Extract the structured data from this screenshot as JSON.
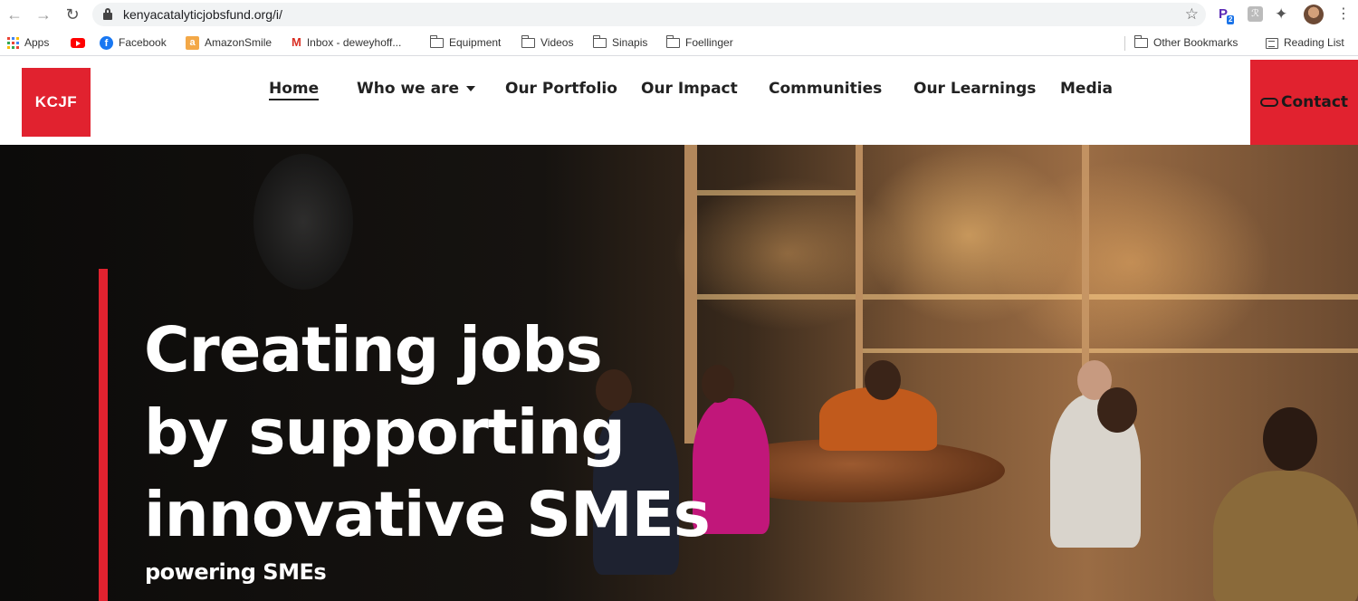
{
  "browser": {
    "url": "kenyacatalyticjobsfund.org/i/",
    "bookmarks": [
      {
        "label": "Apps",
        "icon": "apps-grid-icon"
      },
      {
        "label": "",
        "icon": "youtube-icon"
      },
      {
        "label": "Facebook",
        "icon": "facebook-icon"
      },
      {
        "label": "AmazonSmile",
        "icon": "amazon-icon"
      },
      {
        "label": "Inbox - deweyhoff...",
        "icon": "gmail-icon"
      },
      {
        "label": "Equipment",
        "icon": "folder-icon"
      },
      {
        "label": "Videos",
        "icon": "folder-icon"
      },
      {
        "label": "Sinapis",
        "icon": "folder-icon"
      },
      {
        "label": "Foellinger",
        "icon": "folder-icon"
      }
    ],
    "other_bookmarks": "Other Bookmarks",
    "reading_list": "Reading List",
    "extension_badge": "2"
  },
  "site": {
    "logo_text": "KCJF",
    "nav": [
      {
        "label": "Home",
        "active": true
      },
      {
        "label": "Who we are",
        "dropdown": true
      },
      {
        "label": "Our Portfolio"
      },
      {
        "label": "Our Impact"
      },
      {
        "label": "Communities"
      },
      {
        "label": "Our Learnings"
      },
      {
        "label": "Media"
      }
    ],
    "contact_label": "Contact"
  },
  "hero": {
    "title_lines": [
      "Creating jobs",
      "by supporting",
      "innovative SMEs"
    ],
    "subtitle": "powering SMEs"
  },
  "colors": {
    "brand_red": "#e1222f",
    "text_dark": "#222222",
    "hero_text": "#ffffff"
  }
}
